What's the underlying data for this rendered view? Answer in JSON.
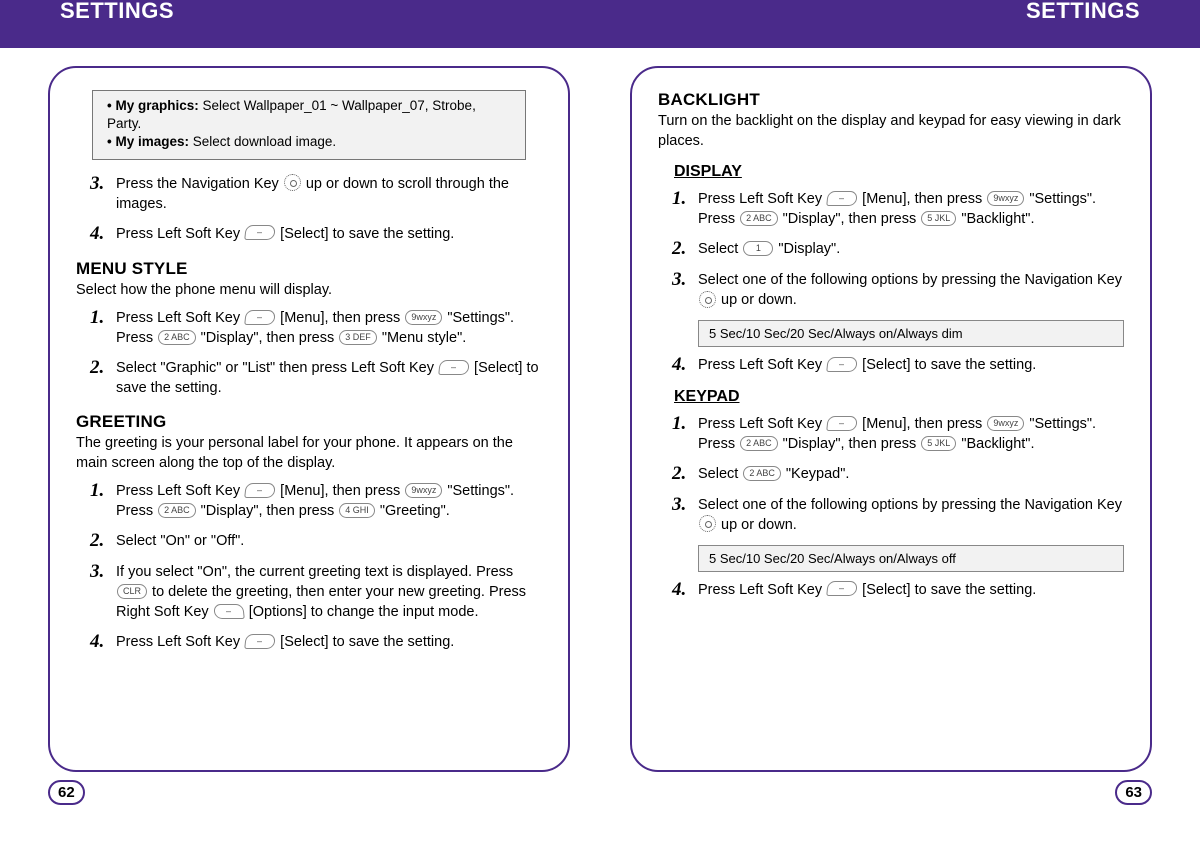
{
  "header": {
    "left": "SETTINGS",
    "right": "SETTINGS"
  },
  "left_page": {
    "note": {
      "rows": [
        {
          "label": "My graphics:",
          "text": "Select Wallpaper_01 ~  Wallpaper_07, Strobe, Party."
        },
        {
          "label": "My images:",
          "text": "Select download image."
        }
      ]
    },
    "intro_steps": [
      {
        "n": "3.",
        "pre": "Press the Navigation Key ",
        "icon": "nav",
        "post": " up or down to scroll through the images."
      },
      {
        "n": "4.",
        "pre": "Press Left Soft Key ",
        "key": "–",
        "post": " [Select] to save the setting."
      }
    ],
    "menu_style": {
      "title": "MENU STYLE",
      "sub": "Select how the phone menu will display.",
      "steps": [
        {
          "n": "1.",
          "line1a": "Press Left Soft Key ",
          "k1": "–",
          "line1b": " [Menu], then press ",
          "k2": "9wxyz",
          "line1c": " \"Settings\".",
          "line2a": "Press ",
          "k3": "2 ABC",
          "line2b": " \"Display\", then press ",
          "k4": "3 DEF",
          "line2c": " \"Menu style\"."
        },
        {
          "n": "2.",
          "text_a": "Select \"Graphic\" or \"List\" then press Left Soft Key ",
          "k1": "–",
          "text_b": " [Select] to save the setting."
        }
      ]
    },
    "greeting": {
      "title": "GREETING",
      "sub": "The greeting is your personal label for your phone. It appears on the main screen along the top of the display.",
      "steps": [
        {
          "n": "1.",
          "line1a": "Press Left Soft Key ",
          "k1": "–",
          "line1b": " [Menu], then press ",
          "k2": "9wxyz",
          "line1c": " \"Settings\".",
          "line2a": "Press ",
          "k3": "2 ABC",
          "line2b": " \"Display\", then press ",
          "k4": "4 GHI",
          "line2c": " \"Greeting\"."
        },
        {
          "n": "2.",
          "text": "Select \"On\" or \"Off\"."
        },
        {
          "n": "3.",
          "text_a": "If you select \"On\", the current greeting text is displayed. Press ",
          "k1": "CLR",
          "text_b": " to delete the greeting, then enter your new greeting. Press Right Soft Key ",
          "k2": "–",
          "text_c": " [Options] to change the input mode."
        },
        {
          "n": "4.",
          "text_a": "Press Left Soft Key ",
          "k1": "–",
          "text_b": " [Select] to save the setting."
        }
      ]
    },
    "page_number": "62"
  },
  "right_page": {
    "backlight": {
      "title": "BACKLIGHT",
      "sub": "Turn on the backlight on the display and keypad for easy viewing in dark places."
    },
    "display": {
      "head": "DISPLAY",
      "steps": [
        {
          "n": "1.",
          "line1a": "Press Left Soft Key ",
          "k1": "–",
          "line1b": " [Menu], then press ",
          "k2": "9wxyz",
          "line1c": " \"Settings\".",
          "line2a": "Press ",
          "k3": "2 ABC",
          "line2b": " \"Display\", then press ",
          "k4": "5 JKL",
          "line2c": " \"Backlight\"."
        },
        {
          "n": "2.",
          "text_a": "Select ",
          "k1": "1",
          "text_b": " \"Display\"."
        },
        {
          "n": "3.",
          "text_a": "Select one of the following options by pressing the Navigation Key ",
          "icon": "nav",
          "text_b": " up or down."
        }
      ],
      "options": "5 Sec/10 Sec/20 Sec/Always on/Always dim",
      "step4": {
        "n": "4.",
        "text_a": "Press Left Soft Key ",
        "k1": "–",
        "text_b": " [Select] to save the setting."
      }
    },
    "keypad": {
      "head": "KEYPAD",
      "steps": [
        {
          "n": "1.",
          "line1a": "Press Left Soft Key ",
          "k1": "–",
          "line1b": " [Menu], then press ",
          "k2": "9wxyz",
          "line1c": " \"Settings\".",
          "line2a": "Press ",
          "k3": "2 ABC",
          "line2b": " \"Display\", then press ",
          "k4": "5 JKL",
          "line2c": " \"Backlight\"."
        },
        {
          "n": "2.",
          "text_a": "Select ",
          "k1": "2 ABC",
          "text_b": " \"Keypad\"."
        },
        {
          "n": "3.",
          "text_a": "Select one of the following options by pressing the Navigation Key ",
          "icon": "nav",
          "text_b": " up or down."
        }
      ],
      "options": "5 Sec/10 Sec/20 Sec/Always on/Always off",
      "step4": {
        "n": "4.",
        "text_a": "Press Left Soft Key ",
        "k1": "–",
        "text_b": " [Select] to save the setting."
      }
    },
    "page_number": "63"
  }
}
